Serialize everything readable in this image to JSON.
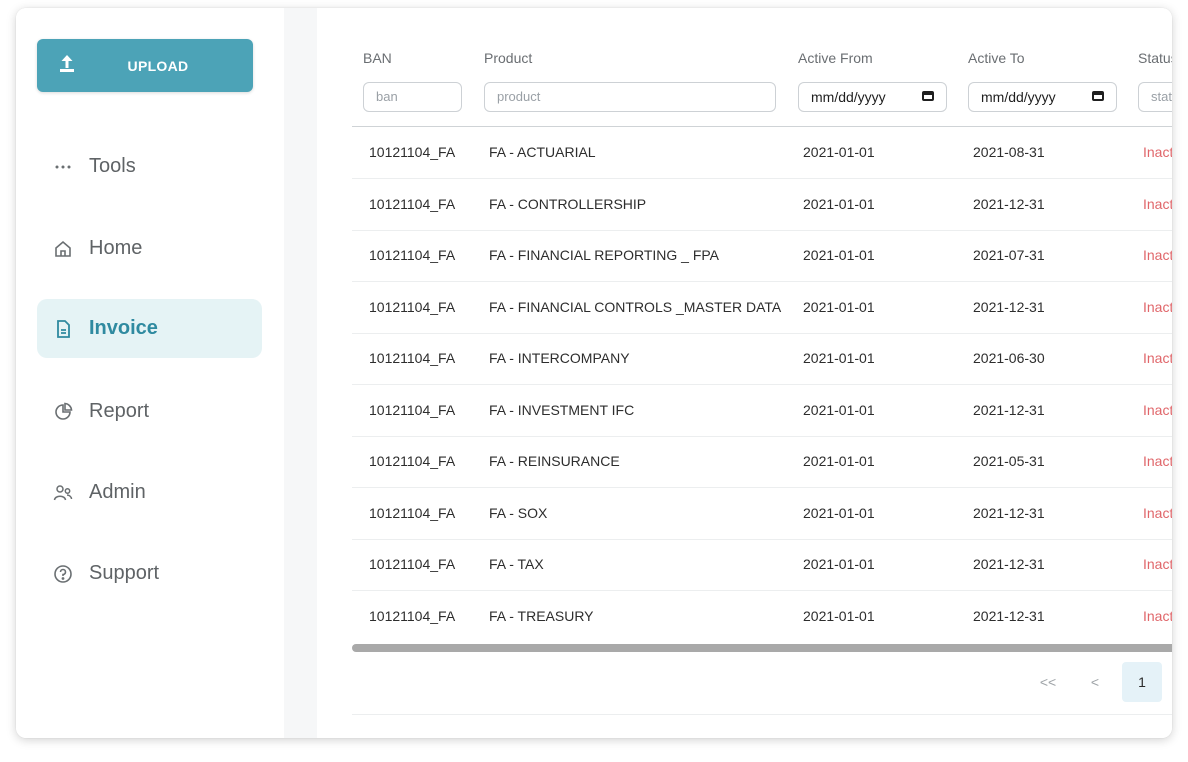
{
  "sidebar": {
    "upload_label": "UPLOAD",
    "items": [
      {
        "label": "Tools",
        "icon": "more-dots-icon"
      },
      {
        "label": "Home",
        "icon": "home-icon"
      },
      {
        "label": "Invoice",
        "icon": "document-icon",
        "active": true
      },
      {
        "label": "Report",
        "icon": "pie-chart-icon"
      },
      {
        "label": "Admin",
        "icon": "users-icon"
      },
      {
        "label": "Support",
        "icon": "help-circle-icon"
      }
    ]
  },
  "table": {
    "columns": [
      "BAN",
      "Product",
      "Active From",
      "Active To",
      "Status"
    ],
    "filters": {
      "ban_placeholder": "ban",
      "product_placeholder": "product",
      "active_from": "mm/dd/yyyy",
      "active_to": "mm/dd/yyyy",
      "status_placeholder": "status"
    },
    "rows": [
      {
        "ban": "10121104_FA",
        "product": "FA - ACTUARIAL",
        "from": "2021-01-01",
        "to": "2021-08-31",
        "status": "Inactive"
      },
      {
        "ban": "10121104_FA",
        "product": "FA - CONTROLLERSHIP",
        "from": "2021-01-01",
        "to": "2021-12-31",
        "status": "Inactive"
      },
      {
        "ban": "10121104_FA",
        "product": "FA - FINANCIAL REPORTING _ FPA",
        "from": "2021-01-01",
        "to": "2021-07-31",
        "status": "Inactive"
      },
      {
        "ban": "10121104_FA",
        "product": "FA - FINANCIAL CONTROLS _MASTER DATA",
        "from": "2021-01-01",
        "to": "2021-12-31",
        "status": "Inactive"
      },
      {
        "ban": "10121104_FA",
        "product": "FA - INTERCOMPANY",
        "from": "2021-01-01",
        "to": "2021-06-30",
        "status": "Inactive"
      },
      {
        "ban": "10121104_FA",
        "product": "FA - INVESTMENT IFC",
        "from": "2021-01-01",
        "to": "2021-12-31",
        "status": "Inactive"
      },
      {
        "ban": "10121104_FA",
        "product": "FA - REINSURANCE",
        "from": "2021-01-01",
        "to": "2021-05-31",
        "status": "Inactive"
      },
      {
        "ban": "10121104_FA",
        "product": "FA - SOX",
        "from": "2021-01-01",
        "to": "2021-12-31",
        "status": "Inactive"
      },
      {
        "ban": "10121104_FA",
        "product": "FA - TAX",
        "from": "2021-01-01",
        "to": "2021-12-31",
        "status": "Inactive"
      },
      {
        "ban": "10121104_FA",
        "product": "FA - TREASURY",
        "from": "2021-01-01",
        "to": "2021-12-31",
        "status": "Inactive"
      }
    ]
  },
  "pager": {
    "first": "<<",
    "prev": "<",
    "current": "1"
  },
  "colors": {
    "accent": "#4ca3b7",
    "active_bg": "#e5f3f5",
    "inactive_status": "#e0666a"
  }
}
